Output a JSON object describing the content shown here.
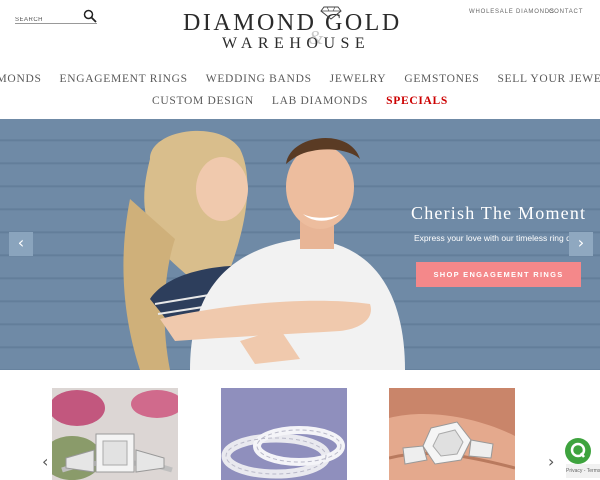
{
  "header": {
    "search_placeholder": "SEARCH",
    "logo_line1": "DIAMOND GOLD",
    "logo_line2": "WAREHOUSE",
    "logo_amp": "&",
    "utility_links": [
      "WHOLESALE DIAMONDS",
      "CONTACT"
    ]
  },
  "nav": {
    "row1": [
      "DIAMONDS",
      "ENGAGEMENT RINGS",
      "WEDDING BANDS",
      "JEWELRY",
      "GEMSTONES",
      "SELL YOUR JEWELRY"
    ],
    "row2": [
      "CUSTOM DESIGN",
      "LAB DIAMONDS",
      "SPECIALS"
    ]
  },
  "hero": {
    "title": "Cherish The Moment",
    "subtitle": "Express your love with our timeless ring desi",
    "cta": "SHOP ENGAGEMENT RINGS",
    "prev_glyph": "‹",
    "next_glyph": "›"
  },
  "carousel": {
    "prev_glyph": "‹",
    "next_glyph": "›"
  },
  "legal": "Privacy - Terms",
  "colors": {
    "accent_red": "#cc0000",
    "cta_pink": "#f4888a",
    "hero_bg": "#6f8aa6",
    "chat_green": "#3ea33e"
  }
}
